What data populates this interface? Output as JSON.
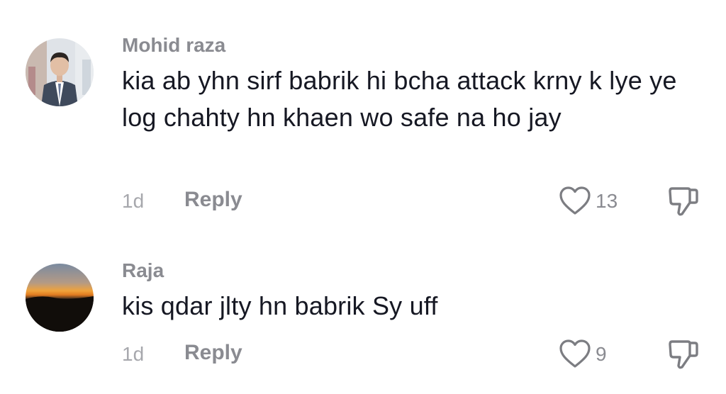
{
  "comments": [
    {
      "username": "Mohid raza",
      "avatar_icon": "child-in-suit-avatar",
      "text": "kia ab yhn sirf babrik hi bcha attack krny k lye ye log chahty hn khaen wo safe na ho jay",
      "time": "1d",
      "reply_label": "Reply",
      "like_icon": "heart-outline-icon",
      "like_count": "13",
      "dislike_icon": "thumbs-down-icon"
    },
    {
      "username": "Raja",
      "avatar_icon": "sunset-avatar",
      "text": "kis qdar jlty hn babrik Sy uff",
      "time": "1d",
      "reply_label": "Reply",
      "like_icon": "heart-outline-icon",
      "like_count": "9",
      "dislike_icon": "thumbs-down-icon"
    }
  ],
  "colors": {
    "username": "#8a8b91",
    "text": "#161823",
    "meta": "#a7a8ad",
    "icon": "#7c7d82"
  }
}
